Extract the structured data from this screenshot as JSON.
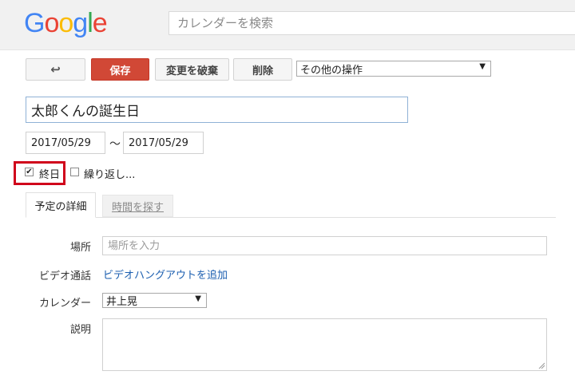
{
  "header": {
    "logo_letters": [
      "G",
      "o",
      "o",
      "g",
      "l",
      "e"
    ],
    "logo_colors": [
      "#4285f4",
      "#ea4335",
      "#fbbc05",
      "#4285f4",
      "#34a853",
      "#ea4335"
    ],
    "search_placeholder": "カレンダーを検索"
  },
  "toolbar": {
    "back_icon": "back-arrow-icon",
    "back_glyph": "↩",
    "save_label": "保存",
    "discard_label": "変更を破棄",
    "delete_label": "削除",
    "more_actions_label": "その他の操作",
    "save_color": "#d14836"
  },
  "event": {
    "title": "太郎くんの誕生日",
    "start_date": "2017/05/29",
    "separator": "～",
    "end_date": "2017/05/29",
    "allday_label": "終日",
    "allday_checked": true,
    "repeat_label": "繰り返し...",
    "repeat_checked": false
  },
  "tabs": [
    {
      "label": "予定の詳細",
      "active": true
    },
    {
      "label": "時間を探す",
      "active": false
    }
  ],
  "details": {
    "place_label": "場所",
    "place_placeholder": "場所を入力",
    "video_label": "ビデオ通話",
    "video_link": "ビデオハングアウトを追加",
    "calendar_label": "カレンダー",
    "calendar_value": "井上晃",
    "description_label": "説明"
  }
}
